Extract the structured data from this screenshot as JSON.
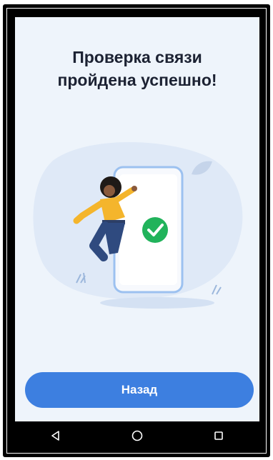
{
  "screen": {
    "title_line1": "Проверка связи",
    "title_line2": "пройдена успешно!",
    "illustration_icon": "success-check-icon",
    "back_button_label": "Назад"
  },
  "navbar": {
    "back_icon": "nav-back-triangle-icon",
    "home_icon": "nav-home-circle-icon",
    "recents_icon": "nav-recents-square-icon"
  },
  "colors": {
    "background": "#eef4fb",
    "accent": "#3d7fe0",
    "success": "#21b35b",
    "title": "#1c2233"
  }
}
